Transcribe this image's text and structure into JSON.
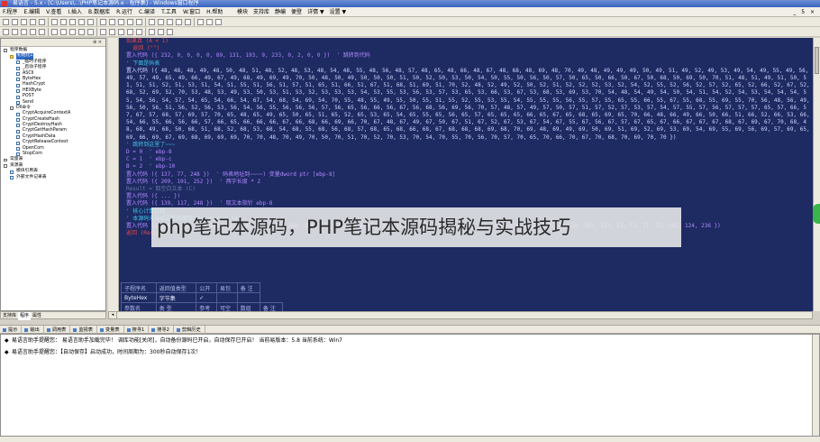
{
  "window": {
    "title": "易语言 - 5.x - [C:\\Users\\...\\PHP笔记本源码.e - 程序集] - Windows窗口程序"
  },
  "menubar": {
    "main": [
      "F.程序",
      "E.编辑",
      "V.查看",
      "I.插入",
      "B.数据库",
      "R.运行",
      "C.编译",
      "T.工具",
      "W.窗口",
      "H.帮助"
    ],
    "extra": [
      "模块",
      "支持库",
      "静编",
      "便登",
      "详情 ▼",
      "设置 ▼"
    ],
    "window_controls": "_ 5 ×"
  },
  "left_panel": {
    "header_controls": "⊕ ×",
    "tree": [
      {
        "text": "程序数据",
        "indent": 0,
        "icon": "expand"
      },
      {
        "text": "初始化1",
        "indent": 1,
        "icon": "folder",
        "selected": true
      },
      {
        "text": "_临时子程序",
        "indent": 2,
        "icon": "sub"
      },
      {
        "text": "_启动子程序",
        "indent": 2,
        "icon": "sub"
      },
      {
        "text": "ASCII",
        "indent": 2,
        "icon": "sub"
      },
      {
        "text": "ByteHex",
        "indent": 2,
        "icon": "sub"
      },
      {
        "text": "HashCrypt",
        "indent": 2,
        "icon": "sub"
      },
      {
        "text": "HEXByte",
        "indent": 2,
        "icon": "sub"
      },
      {
        "text": "POST",
        "indent": 2,
        "icon": "sub"
      },
      {
        "text": "Send",
        "indent": 2,
        "icon": "sub"
      },
      {
        "text": "Dll命令",
        "indent": 1,
        "icon": "expand"
      },
      {
        "text": "CryptAcquireContextA",
        "indent": 2,
        "icon": "sub"
      },
      {
        "text": "CryptCreateHash",
        "indent": 2,
        "icon": "sub"
      },
      {
        "text": "CryptDestroyHash",
        "indent": 2,
        "icon": "sub"
      },
      {
        "text": "CryptGetHashParam",
        "indent": 2,
        "icon": "sub"
      },
      {
        "text": "CryptHashData",
        "indent": 2,
        "icon": "sub"
      },
      {
        "text": "CryptReleaseContext",
        "indent": 2,
        "icon": "sub"
      },
      {
        "text": "OpenCom",
        "indent": 2,
        "icon": "sub"
      },
      {
        "text": "StopCom",
        "indent": 2,
        "icon": "sub"
      },
      {
        "text": "常量表",
        "indent": 0,
        "icon": "expand"
      },
      {
        "text": "资源表",
        "indent": 0,
        "icon": "expand"
      },
      {
        "text": "模块引用表",
        "indent": 1,
        "icon": "sub"
      },
      {
        "text": "外部文件记录表",
        "indent": 1,
        "icon": "sub"
      }
    ],
    "tabs": [
      "支持库",
      "程序",
      "属性"
    ]
  },
  "editor": {
    "lines": [
      {
        "text": "如果真 (A < 1)",
        "cls": "red"
      },
      {
        "text": "  返回 (\"\")",
        "cls": "red"
      },
      {
        "text": "置入代码 ({ 232, 0, 0, 0, 0, 89, 131, 193, 9, 233, 0, 2, 0, 0 })  ' 跳转到代码",
        "cls": "purple"
      },
      {
        "text": "' 下面是码表",
        "cls": "cyan"
      },
      {
        "text": "置入代码 ({ 48, 48, 48, 49, 48, 50, 48, 51, 48, 52, 48, 53, 48, 54, 48, 55, 48, 56, 48, 57, 48, 65, 48, 66, 48, 67, 48, 68, 48, 69, 48, 70, 49, 48, 49, 49, 49, 50, 49, 51, 49, 52, 49, 53, 49, 54, 49, 55, 49, 56, 49, 57, 49, 65, 49, 66, 49, 67, 49, 68, 49, 69, 49, 70, 50, 48, 50, 49, 50, 50, 50, 51, 50, 52, 50, 53, 50, 54, 50, 55, 50, 56, 50, 57, 50, 65, 50, 66, 50, 67, 50, 68, 50, 69, 50, 70, 51, 48, 51, 49, 51, 50, 51, 51, 51, 52, 51, 53, 51, 54, 51, 55, 51, 56, 51, 57, 51, 65, 51, 66, 51, 67, 51, 68, 51, 69, 51, 70, 52, 48, 52, 49, 52, 50, 52, 51, 52, 52, 52, 53, 52, 54, 52, 55, 52, 56, 52, 57, 52, 65, 52, 66, 52, 67, 52, 68, 52, 69, 52, 70, 53, 48, 53, 49, 53, 50, 53, 51, 53, 52, 53, 53, 53, 54, 53, 55, 53, 56, 53, 57, 53, 65, 53, 66, 53, 67, 53, 68, 53, 69, 53, 70, 54, 48, 54, 49, 54, 50, 54, 51, 54, 52, 54, 53, 54, 54, 54, 55, 54, 56, 54, 57, 54, 65, 54, 66, 54, 67, 54, 68, 54, 69, 54, 70, 55, 48, 55, 49, 55, 50, 55, 51, 55, 52, 55, 53, 55, 54, 55, 55, 55, 56, 55, 57, 55, 65, 55, 66, 55, 67, 55, 68, 55, 69, 55, 70, 56, 48, 56, 49, 56, 50, 56, 51, 56, 52, 56, 53, 56, 54, 56, 55, 56, 56, 56, 57, 56, 65, 56, 66, 56, 67, 56, 68, 56, 69, 56, 70, 57, 48, 57, 49, 57, 50, 57, 51, 57, 52, 57, 53, 57, 54, 57, 55, 57, 56, 57, 57, 57, 65, 57, 66, 57, 67, 57, 68, 57, 69, 57, 70, 65, 48, 65, 49, 65, 50, 65, 51, 65, 52, 65, 53, 65, 54, 65, 55, 65, 56, 65, 57, 65, 65, 65, 66, 65, 67, 65, 68, 65, 69, 65, 70, 66, 48, 66, 49, 66, 50, 66, 51, 66, 52, 66, 53, 66, 54, 66, 55, 66, 56, 66, 57, 66, 65, 66, 66, 66, 67, 66, 68, 66, 69, 66, 70, 67, 48, 67, 49, 67, 50, 67, 51, 67, 52, 67, 53, 67, 54, 67, 55, 67, 56, 67, 57, 67, 65, 67, 66, 67, 67, 67, 68, 67, 69, 67, 70, 68, 48, 68, 49, 68, 50, 68, 51, 68, 52, 68, 53, 68, 54, 68, 55, 68, 56, 68, 57, 68, 65, 68, 66, 68, 67, 68, 68, 68, 69, 68, 70, 69, 48, 69, 49, 69, 50, 69, 51, 69, 52, 69, 53, 69, 54, 69, 55, 69, 56, 69, 57, 69, 65, 69, 66, 69, 67, 69, 68, 69, 69, 69, 70, 70, 48, 70, 49, 70, 50, 70, 51, 70, 52, 70, 53, 70, 54, 70, 55, 70, 56, 70, 57, 70, 65, 70, 66, 70, 67, 70, 68, 70, 69, 70, 70 })",
        "cls": "nums"
      },
      {
        "text": "' 跳转到这里了~~~",
        "cls": "cyan"
      },
      {
        "text": "D = 0  ' ebp-8",
        "cls": "purple"
      },
      {
        "text": "C = 1  ' ebp-c",
        "cls": "purple"
      },
      {
        "text": "B = 2  ' ebp-10",
        "cls": "purple"
      },
      {
        "text": "置入代码 ({ 137, 77, 248 })  ' 码表地址到~~~~) 变量dword ptr [ebp-8]",
        "cls": "purple"
      },
      {
        "text": "置入代码 ({ 209, 101, 252 })  ' 两字长度 * 2",
        "cls": "purple"
      },
      {
        "text": "Result = 取空白文本 (C)",
        "cls": "faint"
      },
      {
        "text": "置入代码 ({ ... })",
        "cls": "purple"
      },
      {
        "text": "置入代码 ({ 139, 117, 248 })  ' 取文本指针 ebp-8",
        "cls": "purple"
      },
      {
        "text": "' 核心计算过程",
        "cls": "cyan"
      },
      {
        "text": "' 本源码来自易语言资源网(www.eyuyan.la)",
        "cls": "cyan"
      },
      {
        "text": "置入代码 ({ 139, 117, 240, 139, 93, 248, 139, 125, 244, 209, 109, 252, 139, 77, 252, 3, 206, 51, 192, 138, 6, 70, 209, 224, 102, 139, 20, 24, 102, 137, 23, 71, 71, 59, 241, 124, 236 })",
        "cls": "purple"
      },
      {
        "text": "返回 (Result)",
        "cls": "red"
      }
    ],
    "params_table": {
      "headers": [
        "子程序名",
        "返回值类型",
        "公开",
        "易包",
        "备 注"
      ],
      "row": [
        "ByteHex",
        "字节集",
        "✓",
        "",
        ""
      ],
      "headers2": [
        "参数名",
        "类 型",
        "参考",
        "可空",
        "数组",
        "备 注"
      ]
    },
    "overlay_text": "php笔记本源码，PHP笔记本源码揭秘与实战技巧"
  },
  "bottom_tabs": [
    "提示",
    "输出",
    "调用表",
    "监视表",
    "变量表",
    "搜寻1",
    "搜寻2",
    "剪辑历史"
  ],
  "output": {
    "lines": [
      "易语言助手提醒您：  易语言助手加载完毕！ 调库功能[关闭]，自动备份源码已开启，自动保存已开启！  当前易版本：5.8  当前系统：Win7",
      "易语言助手提醒您：【自动保存】启动成功，时间周期为：300秒自动保存1次！"
    ]
  },
  "colors": {
    "editor_bg": "#1e2a62",
    "keyword": "#e04a4a",
    "comment": "#3fc6e8",
    "code": "#b089ff"
  }
}
